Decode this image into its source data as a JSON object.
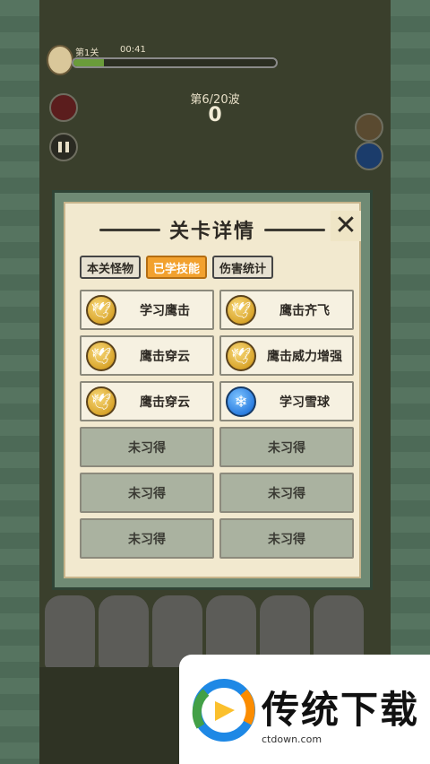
{
  "hud": {
    "level": "第1关",
    "timer": "00:41",
    "progress": 0.15,
    "wave": "第6/20波",
    "score": "0"
  },
  "modal": {
    "title": "关卡详情",
    "close_icon": "close-x-icon",
    "tabs": [
      {
        "label": "本关怪物",
        "active": false
      },
      {
        "label": "已学技能",
        "active": true
      },
      {
        "label": "伤害统计",
        "active": false
      }
    ],
    "skills": [
      {
        "label": "学习鹰击",
        "icon": "eagle"
      },
      {
        "label": "鹰击齐飞",
        "icon": "eagle"
      },
      {
        "label": "鹰击穿云",
        "icon": "eagle"
      },
      {
        "label": "鹰击威力增强",
        "icon": "eagle"
      },
      {
        "label": "鹰击穿云",
        "icon": "eagle"
      },
      {
        "label": "学习雪球",
        "icon": "snowball"
      },
      {
        "label": "未习得"
      },
      {
        "label": "未习得"
      },
      {
        "label": "未习得"
      },
      {
        "label": "未习得"
      },
      {
        "label": "未习得"
      },
      {
        "label": "未习得"
      }
    ]
  },
  "watermark": {
    "brand": "传统下载",
    "url": "ctdown.com"
  },
  "colors": {
    "active_tab": "#f2a12e",
    "panel_bg": "#f2e9cf",
    "frame": "#6f8a74",
    "eagle_gold": "#d9a52c",
    "snow_blue": "#2c7ee0"
  }
}
